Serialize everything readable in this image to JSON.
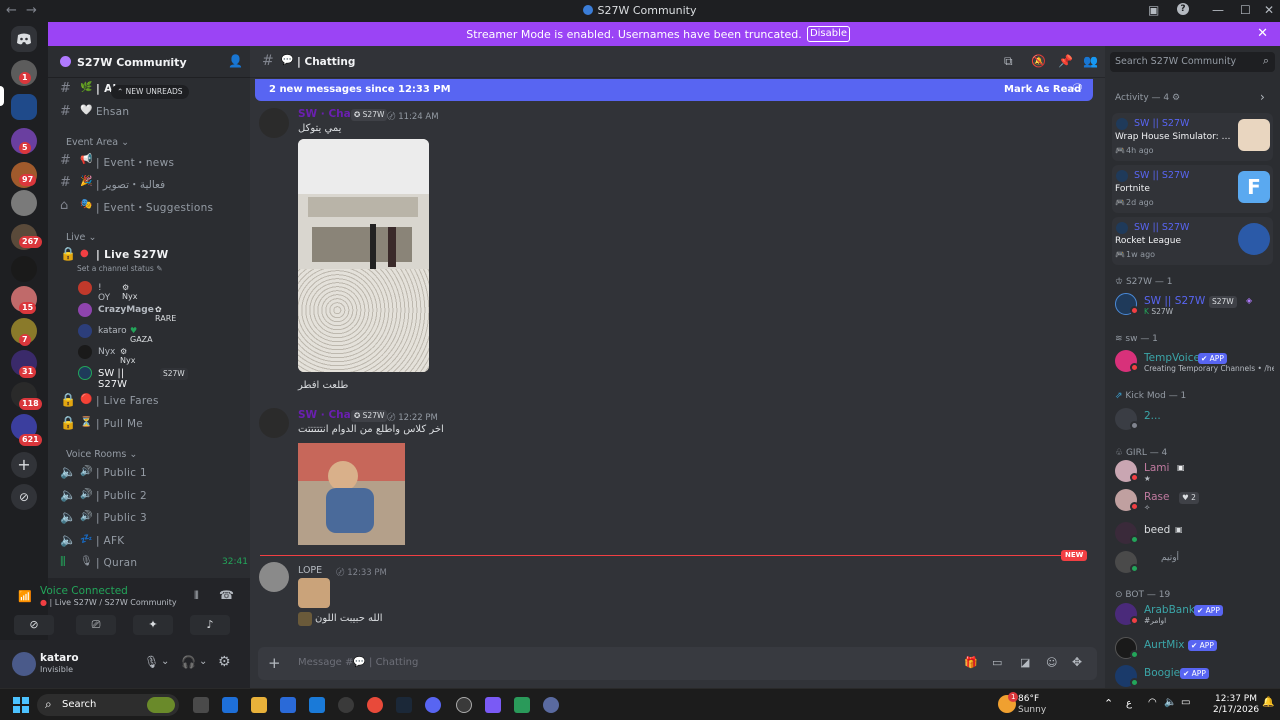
{
  "window": {
    "title": "S27W Community",
    "nav_back": "←",
    "nav_forward": "→"
  },
  "banner": {
    "message": "Streamer Mode is enabled. Usernames have been truncated.",
    "disable_label": "Disable",
    "color": "#9b44f5"
  },
  "servers": {
    "badges": [
      "1",
      "5",
      "97",
      "267",
      "15",
      "7",
      "31",
      "118",
      "621"
    ]
  },
  "guild": {
    "name": "S27W Community",
    "new_unreads_label": "NEW UNREADS"
  },
  "channels": {
    "top": [
      {
        "emoji": "🌿",
        "label": "| Al",
        "active": true
      },
      {
        "emoji": "🤍",
        "label": "Ehsan"
      }
    ],
    "event_area_label": "Event Area",
    "event": [
      {
        "emoji": "📢",
        "label": "| Event・news"
      },
      {
        "emoji": "🎉",
        "label": "| فعالية・تصوير"
      },
      {
        "emoji": "🎭",
        "label": "| Event・Suggestions"
      }
    ],
    "live_label": "Live",
    "live_channel": "| Live S27W",
    "set_status": "Set a channel status",
    "voice_users": [
      {
        "name": "! OY",
        "tag": "Nyx"
      },
      {
        "name": "CrazyMage",
        "tag": "RARE"
      },
      {
        "name": "kataro",
        "tag": "GAZA"
      },
      {
        "name": "Nyx",
        "tag": "Nyx"
      },
      {
        "name": "SW || S27W",
        "tag": "S27W"
      }
    ],
    "more": [
      {
        "emoji": "🔴",
        "label": "| Live Fares"
      },
      {
        "emoji": "⏳",
        "label": "| Pull Me"
      }
    ],
    "voice_rooms_label": "Voice Rooms",
    "voice_rooms": [
      {
        "emoji": "🔊",
        "label": "| Public 1"
      },
      {
        "emoji": "🔊",
        "label": "| Public 2"
      },
      {
        "emoji": "🔊",
        "label": "| Public 3"
      },
      {
        "emoji": "💤",
        "label": "| AFK"
      },
      {
        "emoji": "🎙",
        "label": "| Quran",
        "timer": "32:41"
      }
    ]
  },
  "voice_panel": {
    "status": "Voice Connected",
    "location": "| Live S27W / S27W Community"
  },
  "user_panel": {
    "name": "kataro",
    "status": "Invisible"
  },
  "channel": {
    "name": "| Chatting",
    "new_messages": "2 new messages since 12:33 PM",
    "mark_read": "Mark As Read",
    "new_label": "NEW",
    "composer_placeholder": "Message #💬 | Chatting"
  },
  "messages": [
    {
      "clan": "S27W",
      "time": "11:24 AM",
      "text": "يمي يتوكل",
      "caption": "طلعت افطر"
    },
    {
      "clan": "S27W",
      "time": "12:22 PM",
      "text": "اخر كلاس واطلع من الدوام انتتتتتت"
    },
    {
      "name": "LOPE",
      "time": "12:33 PM",
      "text": "الله حبيبت اللون"
    }
  ],
  "members": {
    "search_placeholder": "Search S27W Community",
    "activity_label": "Activity — 4",
    "activities": [
      {
        "who": "SW || S27W",
        "game": "Wrap House Simulator: Pro...",
        "ago": "4h ago"
      },
      {
        "who": "SW || S27W",
        "game": "Fortnite",
        "ago": "2d ago"
      },
      {
        "who": "SW || S27W",
        "game": "Rocket League",
        "ago": "1w ago"
      }
    ],
    "groups": [
      {
        "label": "S27W — 1"
      },
      {
        "label": "sw — 1"
      },
      {
        "label": "Kick Mod — 1"
      },
      {
        "label": "GIRL — 4"
      },
      {
        "label": "BOT — 19"
      }
    ],
    "s27w_member": {
      "name": "SW || S27W",
      "clan": "S27W",
      "sub": "S27W"
    },
    "sw_member": {
      "name": "TempVoice",
      "badge": "APP",
      "sub": "Creating Temporary Channels • /help"
    },
    "kick_member": {
      "name": "2..."
    },
    "girls": [
      {
        "name": "Lami"
      },
      {
        "name": "Rase",
        "tag": "2"
      },
      {
        "name": "beed"
      },
      {
        "name": "أوتيم"
      }
    ],
    "bots": [
      {
        "name": "ArabBank",
        "badge": "APP",
        "sub": "#اوامر"
      },
      {
        "name": "AurtMix",
        "badge": "APP"
      },
      {
        "name": "Boogie",
        "badge": "APP"
      }
    ]
  },
  "taskbar": {
    "search_label": "Search",
    "weather_temp": "86°F",
    "weather_desc": "Sunny",
    "time": "12:37 PM",
    "date": "2/17/2026",
    "notif_badge": "1",
    "lang": "ع"
  }
}
